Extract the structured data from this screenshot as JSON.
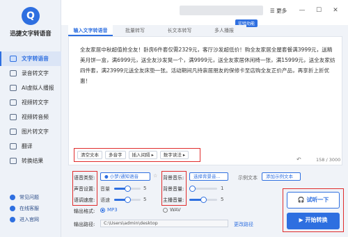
{
  "app": {
    "name": "迅捷文字转语音",
    "logo_text": "Q"
  },
  "sidebar": {
    "items": [
      {
        "label": "文字转语音",
        "active": true
      },
      {
        "label": "录音转文字",
        "active": false
      },
      {
        "label": "AI虚拟人播报",
        "active": false
      },
      {
        "label": "视频转文字",
        "active": false
      },
      {
        "label": "视频转音频",
        "active": false
      },
      {
        "label": "图片转文字",
        "active": false
      },
      {
        "label": "翻译",
        "active": false
      },
      {
        "label": "转换结果",
        "active": false
      }
    ],
    "links": [
      "常见问题",
      "在线客服",
      "进入官网"
    ]
  },
  "titlebar": {
    "more_label": "更多",
    "demo_tag": "实验功能"
  },
  "tabs": [
    "输入文字转语音",
    "批量转写",
    "长文本转写",
    "多人播报"
  ],
  "editor": {
    "text": "全友家居中秋超值抢全友！卧房6件套仅需2329元，客厅沙发超低价！购全友家居全屋套餐满3999元，送精美月饼一盒，满6999元，送全友沙发凳一个，满9999元，送全友家居休闲椅一张，满15999元，送全友家纺四件套，满23999元送全友床垫一张。活动期间凡持崇居朋友的保修卡至店购全友正价产品，再享折上折优惠！",
    "tools": [
      "清空文本",
      "多音字",
      "插入间隔 ▸",
      "数字读法 ▸"
    ],
    "counter": "158 / 3000"
  },
  "settings": {
    "voice_type_label": "语音类型:",
    "voice_name": "小梦/通知语音",
    "volume_label": "声音设置:",
    "volume_sub": "音量",
    "volume_value": "5",
    "volume_level": 0.5,
    "speed_label": "语调速度:",
    "speed_sub": "语速",
    "speed_value": "5",
    "speed_level": 0.5,
    "bg_music_label": "背景音乐:",
    "bg_music_button": "选择背景音...",
    "bg_volume_label": "背景音量:",
    "bg_volume_value": "1",
    "bg_volume_level": 0.1,
    "main_volume_label": "主播音量:",
    "main_volume_value": "5",
    "main_volume_level": 0.5,
    "sample_label": "示例文本",
    "sample_button": "添加示例文本",
    "format_label": "输出格式:",
    "format_mp3": "MP3",
    "format_wav": "WAV",
    "path_label": "输出路径:",
    "path_value": "C:\\Users\\admin\\desktop",
    "change_path": "更改路径"
  },
  "actions": {
    "preview": "试听一下",
    "convert": "开始转换"
  }
}
